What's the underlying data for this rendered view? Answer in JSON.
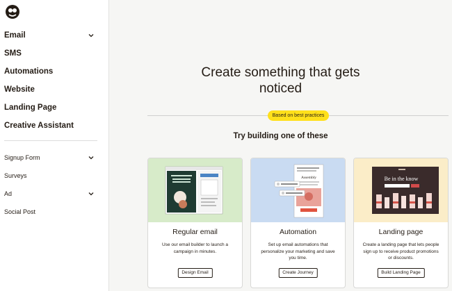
{
  "sidebar": {
    "primary": [
      {
        "label": "Email",
        "has_chevron": true
      },
      {
        "label": "SMS",
        "has_chevron": false
      },
      {
        "label": "Automations",
        "has_chevron": false
      },
      {
        "label": "Website",
        "has_chevron": false
      },
      {
        "label": "Landing Page",
        "has_chevron": false
      },
      {
        "label": "Creative Assistant",
        "has_chevron": false
      }
    ],
    "secondary": [
      {
        "label": "Signup Form",
        "has_chevron": true
      },
      {
        "label": "Surveys",
        "has_chevron": false
      },
      {
        "label": "Ad",
        "has_chevron": true
      },
      {
        "label": "Social Post",
        "has_chevron": false
      }
    ]
  },
  "main": {
    "title_line1": "Create something that gets",
    "title_line2": "noticed",
    "badge": "Based on best practices",
    "subtitle": "Try building one of these",
    "cards": [
      {
        "title": "Regular email",
        "description": "Use our email builder to launch a campaign in minutes.",
        "button": "Design Email",
        "bg": "#d7ebc9"
      },
      {
        "title": "Automation",
        "description": "Set up email automations that personalize your marketing and save you time.",
        "button": "Create Journey",
        "bg": "#c9dbf2",
        "preview_heading": "Assembly"
      },
      {
        "title": "Landing page",
        "description": "Create a landing page that lets people sign up to receive product promotions or discounts.",
        "button": "Build Landing Page",
        "bg": "#fbedc8",
        "preview_heading": "Be in the know"
      }
    ]
  },
  "colors": {
    "accent": "#ffe01b",
    "sidebar_bg": "#ffffff",
    "main_bg": "#f6f6f4"
  }
}
